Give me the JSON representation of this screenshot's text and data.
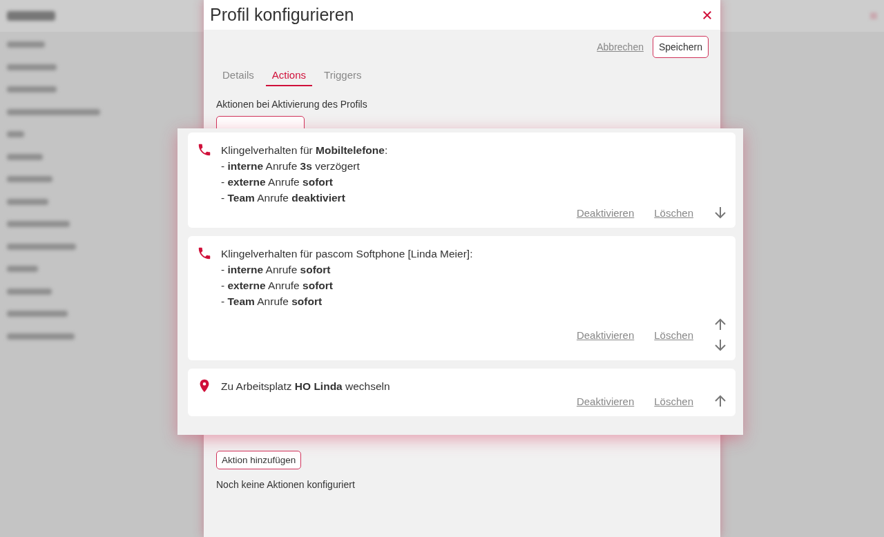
{
  "dialog": {
    "title": "Profil konfigurieren",
    "buttons": [
      {
        "label": "Abbrechen",
        "kind": "link"
      },
      {
        "label": "Speichern",
        "kind": "outlined"
      }
    ],
    "tabs": [
      {
        "label": "Details",
        "selected": false
      },
      {
        "label": "Actions",
        "selected": true
      },
      {
        "label": "Triggers",
        "selected": false
      }
    ],
    "section_heading": "Aktionen bei Aktivierung des Profils",
    "add_button": "Aktion hinzufügen",
    "empty_note": "Noch keine Aktionen konfiguriert"
  },
  "actions_panel": {
    "actions": [
      {
        "kind": "phone",
        "lines": [
          "Klingelverhalten für **Mobiltelefone**:",
          "- **interne** Anrufe **3s** verzögert",
          "- **externe** Anrufe **sofort**",
          "- **Team** Anrufe **deaktiviert**"
        ],
        "links": [
          "Deaktivieren",
          "Löschen"
        ],
        "move_up": false,
        "move_down": true
      },
      {
        "kind": "phone",
        "lines": [
          "Klingelverhalten für pascom Softphone [Linda Meier]:",
          "- **interne** Anrufe **sofort**",
          "- **externe** Anrufe **sofort**",
          "- **Team** Anrufe **sofort**"
        ],
        "links": [
          "Deaktivieren",
          "Löschen"
        ],
        "move_up": true,
        "move_down": true
      },
      {
        "kind": "location",
        "lines": [
          "Zu Arbeitsplatz **HO Linda** wechseln"
        ],
        "links": [
          "Deaktivieren",
          "Löschen"
        ],
        "move_up": true,
        "move_down": false
      }
    ]
  }
}
